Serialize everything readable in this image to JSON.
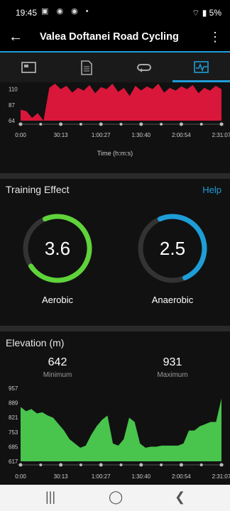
{
  "status": {
    "time": "19:45",
    "battery": "5%"
  },
  "appbar": {
    "title": "Valea Doftanei Road Cycling"
  },
  "tabs": [
    {
      "name": "overview-icon",
      "active": false
    },
    {
      "name": "stats-icon",
      "active": false
    },
    {
      "name": "laps-icon",
      "active": false
    },
    {
      "name": "charts-icon",
      "active": true
    }
  ],
  "hr_chart": {
    "x_label": "Time (h:m:s)",
    "x_ticks": [
      "0:00",
      "30:13",
      "1:00:27",
      "1:30:40",
      "2:00:54",
      "2:31:07"
    ],
    "y_ticks": [
      "110",
      "87",
      "64"
    ]
  },
  "training_effect": {
    "title": "Training Effect",
    "help": "Help",
    "aerobic": {
      "value": "3.6",
      "label": "Aerobic",
      "fraction": 0.72,
      "color": "#5fd33a"
    },
    "anaerobic": {
      "value": "2.5",
      "label": "Anaerobic",
      "fraction": 0.5,
      "color": "#1e9ed8"
    }
  },
  "elevation": {
    "title": "Elevation (m)",
    "min_value": "642",
    "min_label": "Minimum",
    "max_value": "931",
    "max_label": "Maximum"
  },
  "chart_data": [
    {
      "type": "area",
      "title": "",
      "ylabel": "",
      "xlabel": "Time (h:m:s)",
      "x_ticks": [
        "0:00",
        "30:13",
        "1:00:27",
        "1:30:40",
        "2:00:54",
        "2:31:07"
      ],
      "ylim": [
        64,
        120
      ],
      "y_ticks": [
        110,
        87,
        64
      ],
      "series": [
        {
          "color": "#d8173a",
          "values": [
            80,
            78,
            68,
            75,
            0,
            112,
            118,
            110,
            115,
            105,
            112,
            108,
            116,
            104,
            113,
            110,
            118,
            106,
            112,
            100,
            115,
            108,
            114,
            110,
            118,
            105,
            112,
            108,
            114,
            110,
            116,
            104,
            112,
            108,
            115,
            110
          ]
        }
      ]
    },
    {
      "type": "area",
      "title": "Elevation (m)",
      "xlabel": "",
      "x_ticks": [
        "0:00",
        "30:13",
        "1:00:27",
        "1:30:40",
        "2:00:54",
        "2:31:07"
      ],
      "ylim": [
        617,
        957
      ],
      "y_ticks": [
        957,
        889,
        821,
        753,
        685,
        617
      ],
      "series": [
        {
          "color": "#49c44d",
          "values": [
            870,
            850,
            860,
            840,
            845,
            830,
            820,
            790,
            760,
            720,
            700,
            680,
            690,
            740,
            780,
            810,
            830,
            700,
            690,
            720,
            820,
            800,
            700,
            680,
            685,
            685,
            690,
            690,
            690,
            690,
            700,
            760,
            760,
            780,
            790,
            800,
            800,
            910
          ]
        }
      ]
    }
  ],
  "nav": {
    "recents": "|||",
    "home": "◯",
    "back": "❮"
  }
}
